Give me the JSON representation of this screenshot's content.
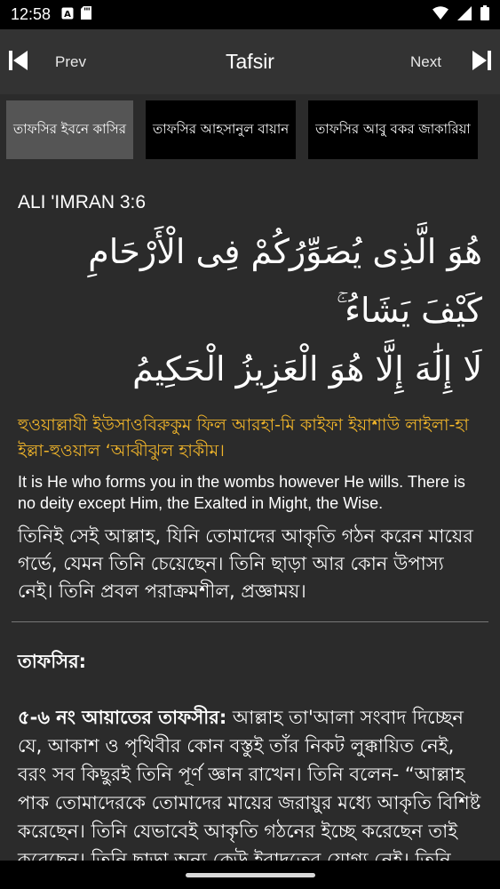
{
  "status_bar": {
    "time": "12:58",
    "left_icons": [
      "a-icon",
      "sd-card-icon"
    ],
    "right_icons": [
      "wifi-icon",
      "signal-icon",
      "battery-icon"
    ]
  },
  "toolbar": {
    "prev_label": "Prev",
    "title": "Tafsir",
    "next_label": "Next"
  },
  "tabs": [
    {
      "label": "তাফসির ইবনে কাসির",
      "active": true
    },
    {
      "label": "তাফসির আহসানুল বায়ান",
      "active": false
    },
    {
      "label": "তাফসির আবু বকর জাকারিয়া",
      "active": false
    }
  ],
  "verse": {
    "reference": "ALI 'IMRAN 3:6",
    "arabic_line1": "هُوَ الَّذِى يُصَوِّرُكُمْ فِى الْأَرْحَامِ كَيْفَ يَشَاءُ ۚ",
    "arabic_line2": "لَا إِلَٰهَ إِلَّا هُوَ الْعَزِيزُ الْحَكِيمُ",
    "transliteration": "হুওয়াল্লাযী ইউসাওবিরুকুম ফিল আরহা-মি কাইফা ইয়াশাউ লাইলা-হা ইল্লা-হুওয়াল ‘আঝীঝুল হাকীম।",
    "english": "It is He who forms you in the wombs however He wills. There is no deity except Him, the Exalted in Might, the Wise.",
    "bangla": "তিনিই সেই আল্লাহ, যিনি তোমাদের আকৃতি গঠন করেন মায়ের গর্ভে, যেমন তিনি চেয়েছেন। তিনি ছাড়া আর কোন উপাস্য নেই। তিনি প্রবল পরাক্রমশীল, প্রজ্ঞাময়।"
  },
  "tafsir": {
    "heading": "তাফসির:",
    "lead": "৫-৬ নং আয়াতের তাফসীর:",
    "body": " আল্লাহ তা'আলা সংবাদ দিচ্ছেন যে, আকাশ ও পৃথিবীর কোন বস্তুই তাঁর নিকট লুক্কায়িত নেই, বরং সব কিছুরই তিনি পূর্ণ জ্ঞান রাখেন। তিনি বলেন- “আল্লাহ পাক তোমাদেরকে তোমাদের মায়ের জরায়ুর মধ্যে আকৃতি বিশিষ্ট করেছেন। তিনি যেভাবেই আকৃতি গঠনের ইচ্ছে করেছেন তাই করেছেন। তিনি ছাড়া অন্য কেউ ইবাদতের যোগ্য নেই। তিনি অতি ক্ষমতাশালী ও বিজ্ঞানময়। এ আয়াতে"
  },
  "colors": {
    "background": "#2b2b2b",
    "toolbar": "#333333",
    "transliteration": "#f1b52a",
    "active_tab": "#555555",
    "inactive_tab": "#000000"
  }
}
